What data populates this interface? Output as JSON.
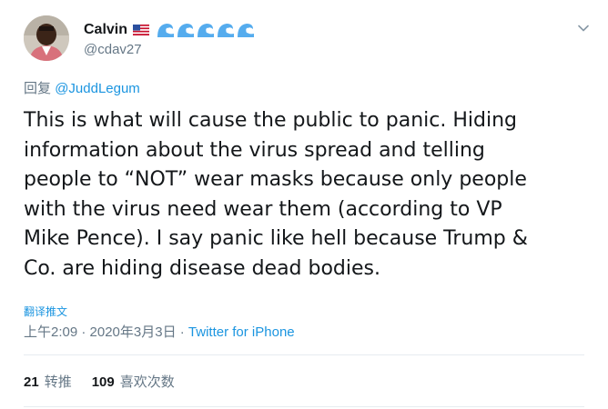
{
  "tweet": {
    "display_name": "Calvin",
    "flag_icon": "us-flag-icon",
    "wave_icons": [
      "wave-icon",
      "wave-icon",
      "wave-icon",
      "wave-icon",
      "wave-icon"
    ],
    "handle": "@cdav27",
    "reply_prefix": "回复",
    "reply_mention": "@JuddLegum",
    "text": "This is what will cause the public to panic. Hiding\ninformation about the virus spread and telling\npeople to “NOT” wear masks because only people\nwith the virus need wear them (according to VP\nMike Pence). I say panic like hell because Trump &\nCo. are hiding disease dead bodies.",
    "translate_label": "翻译推文",
    "timestamp": "上午2:09 · 2020年3月3日 · ",
    "source": "Twitter for iPhone",
    "retweets_count": "21",
    "retweets_label": "转推",
    "likes_count": "109",
    "likes_label": "喜欢次数"
  },
  "colors": {
    "link": "#1b95e0",
    "muted": "#657786",
    "text": "#14171a",
    "divider": "#e6ecf0"
  }
}
